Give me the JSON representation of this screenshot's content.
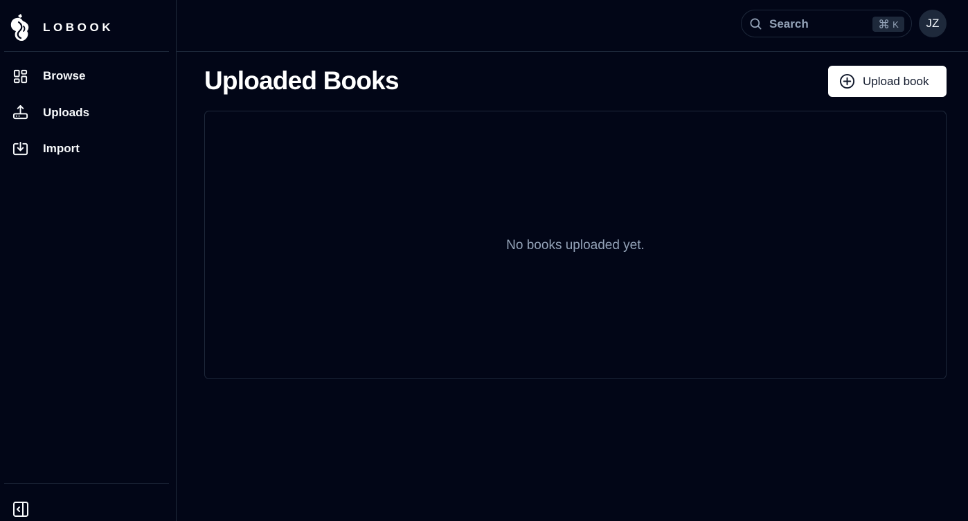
{
  "brand": {
    "name": "LOBOOK",
    "logo_icon": "lobook-logo-icon"
  },
  "sidebar": {
    "items": [
      {
        "label": "Browse",
        "icon": "grid-icon"
      },
      {
        "label": "Uploads",
        "icon": "upload-icon"
      },
      {
        "label": "Import",
        "icon": "import-icon"
      }
    ],
    "collapse_icon": "sidebar-collapse-icon"
  },
  "topbar": {
    "search": {
      "label": "Search",
      "shortcut_symbol": "⌘",
      "shortcut_key": "K"
    },
    "avatar_initials": "JZ"
  },
  "main": {
    "title": "Uploaded Books",
    "upload_button_label": "Upload book",
    "empty_message": "No books uploaded yet."
  },
  "colors": {
    "background": "#020617",
    "border": "#1e293b",
    "muted_text": "#94a3b8",
    "primary_button_bg": "#ffffff"
  }
}
